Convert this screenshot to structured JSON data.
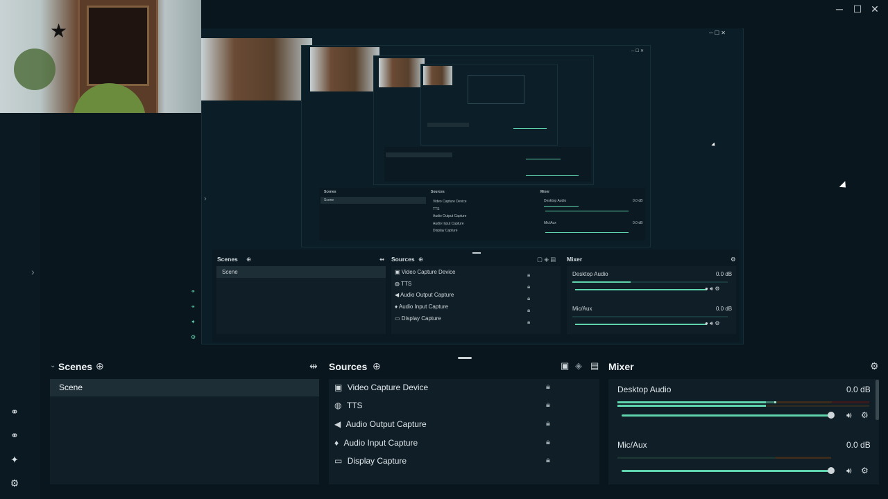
{
  "window": {
    "minimize": "─",
    "maximize": "☐",
    "close": "✕"
  },
  "dock": {
    "scenes": {
      "title": "Scenes",
      "items": [
        "Scene"
      ]
    },
    "sources": {
      "title": "Sources",
      "items": [
        {
          "label": "Video Capture Device",
          "icon": "camera-icon"
        },
        {
          "label": "TTS",
          "icon": "globe-icon"
        },
        {
          "label": "Audio Output Capture",
          "icon": "speaker-icon"
        },
        {
          "label": "Audio Input Capture",
          "icon": "microphone-icon"
        },
        {
          "label": "Display Capture",
          "icon": "monitor-icon"
        }
      ]
    },
    "mixer": {
      "title": "Mixer",
      "channels": [
        {
          "name": "Desktop Audio",
          "db": "0.0 dB",
          "level": 0.8
        },
        {
          "name": "Mic/Aux",
          "db": "0.0 dB",
          "level": 0.0
        }
      ]
    }
  },
  "nested1": {
    "scenes_title": "Scenes",
    "sources_title": "Sources",
    "mixer_title": "Mixer",
    "scene": "Scene",
    "sources": [
      "Video Capture Device",
      "TTS",
      "Audio Output Capture",
      "Audio Input Capture",
      "Display Capture"
    ],
    "channels": [
      {
        "name": "Desktop Audio",
        "db": "0.0 dB"
      },
      {
        "name": "Mic/Aux",
        "db": "0.0 dB"
      }
    ]
  },
  "nested2": {
    "scenes_title": "Scenes",
    "sources_title": "Sources",
    "mixer_title": "Mixer",
    "scene": "Scene",
    "sources": [
      "Video Capture Device",
      "TTS",
      "Audio Output Capture",
      "Audio Input Capture",
      "Display Capture"
    ],
    "channels": [
      {
        "name": "Desktop Audio",
        "db": "0.0 dB"
      },
      {
        "name": "Mic/Aux",
        "db": "0.0 dB"
      }
    ]
  },
  "colors": {
    "accent": "#60d4ad",
    "background": "#09161e",
    "panel": "#101f27",
    "selected": "#1e2e36"
  }
}
